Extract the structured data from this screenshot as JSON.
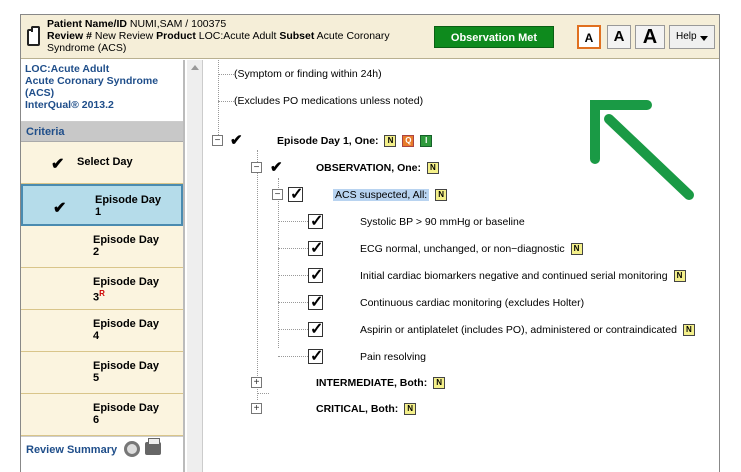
{
  "header": {
    "patient_label": "Patient Name/ID",
    "patient_value": "NUMI,SAM / 100375",
    "review_label": "Review #",
    "review_value": "New Review",
    "product_label": "Product",
    "product_value": "LOC:Acute Adult",
    "subset_label": "Subset",
    "subset_value": "Acute Coronary Syndrome (ACS)",
    "observation_button": "Observation Met",
    "font_small": "A",
    "font_medium": "A",
    "font_large": "A",
    "help_label": "Help"
  },
  "sidebar": {
    "title_lines": [
      "LOC:Acute Adult",
      "Acute Coronary Syndrome",
      "(ACS)",
      "InterQual® 2013.2"
    ],
    "criteria_label": "Criteria",
    "items": [
      {
        "label": "Select Day",
        "checked": "✔"
      },
      {
        "label_line1": "Episode Day",
        "label_line2": "1",
        "checked": "✔"
      },
      {
        "label_line1": "Episode Day",
        "label_line2": "2"
      },
      {
        "label_line1": "Episode Day",
        "label_line2": "3",
        "sup": "R"
      },
      {
        "label_line1": "Episode Day",
        "label_line2": "4"
      },
      {
        "label_line1": "Episode Day",
        "label_line2": "5"
      },
      {
        "label_line1": "Episode Day",
        "label_line2": "6"
      }
    ],
    "review_summary": "Review Summary"
  },
  "tree": {
    "note1": "(Symptom or finding within 24h)",
    "note2": "(Excludes PO medications unless noted)",
    "episode": "Episode Day 1, One:",
    "observation": "OBSERVATION, One:",
    "acs": "ACS suspected, All:",
    "criteria": [
      {
        "text": "Systolic BP > 90 mmHg or baseline",
        "note": false
      },
      {
        "text": "ECG normal, unchanged, or non−diagnostic",
        "note": true
      },
      {
        "text": "Initial cardiac biomarkers negative and continued serial monitoring",
        "note": true
      },
      {
        "text": "Continuous cardiac monitoring (excludes Holter)",
        "note": false
      },
      {
        "text": "Aspirin or antiplatelet (includes PO), administered or contraindicated",
        "note": true
      },
      {
        "text": "Pain resolving",
        "note": false
      }
    ],
    "intermediate": "INTERMEDIATE, Both:",
    "critical": "CRITICAL, Both:",
    "note_icon": "N",
    "q_icon": "Q",
    "t_icon": "I",
    "check_mark": "✔",
    "expander_minus": "−",
    "expander_plus": "+"
  },
  "colors": {
    "observation_button": "#0e8a1d",
    "arrow": "#1a9a45",
    "header_bg": "#f5eed8",
    "sidebar_item_bg": "#fbf4df",
    "active_item_bg": "#b5dcea",
    "highlight": "#b8d3f0"
  }
}
